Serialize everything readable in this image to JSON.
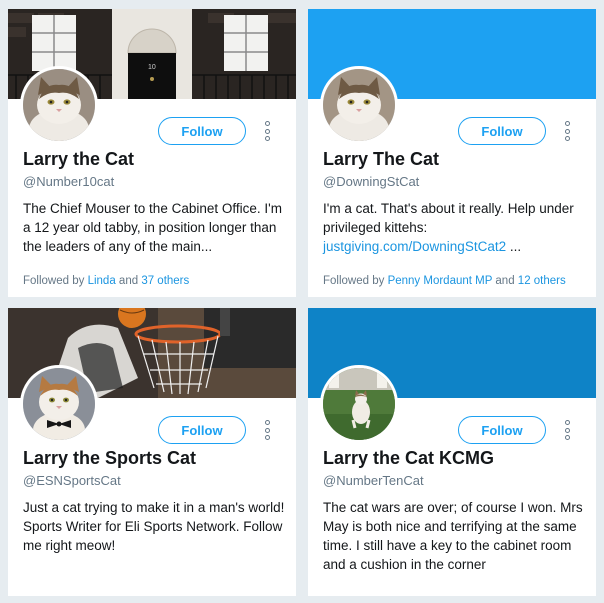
{
  "follow_label": "Follow",
  "colors": {
    "accent": "#1da1f2",
    "link": "#1b95e0",
    "muted": "#657786",
    "text": "#14171a",
    "page_background": "#e6ecf0",
    "banner_blue": "#1da1f2",
    "banner_dark_blue": "#0e83c7"
  },
  "cards": [
    {
      "name": "Larry the Cat",
      "handle": "@Number10cat",
      "bio": "The Chief Mouser to the Cabinet Office. I'm a 12 year old tabby, in position longer than the leaders of any of the main...",
      "followed_prefix": "Followed by",
      "followed_user": "Linda",
      "followed_and": "and",
      "followed_others": "37 others",
      "banner": "photo-downing-street-door",
      "avatar": "photo-cat-portrait"
    },
    {
      "name": "Larry The Cat",
      "handle": "@DowningStCat",
      "bio_text": "I'm a cat. That's about it really. Help under privileged kittehs:",
      "bio_link": "justgiving.com/DowningStCat2",
      "bio_suffix": "...",
      "followed_prefix": "Followed by",
      "followed_user": "Penny Mordaunt MP",
      "followed_and": "and",
      "followed_others": "12 others",
      "banner": "solid-blue",
      "avatar": "photo-cat-portrait"
    },
    {
      "name": "Larry the Sports Cat",
      "handle": "@ESNSportsCat",
      "bio": "Just a cat trying to make it in a man's world! Sports Writer for Eli Sports Network. Follow me right meow!",
      "banner": "photo-basketball-hoop",
      "avatar": "photo-cat-bowtie"
    },
    {
      "name": "Larry the Cat KCMG",
      "handle": "@NumberTenCat",
      "bio": "The cat wars are over; of course I won. Mrs May is both nice and terrifying at the same time. I still have a key to the cabinet room and a cushion in the corner",
      "banner": "solid-dark-blue",
      "avatar": "photo-cat-on-lawn"
    }
  ]
}
